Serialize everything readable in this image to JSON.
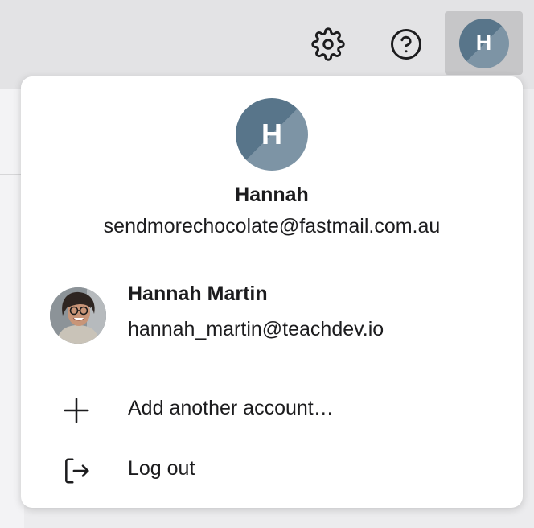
{
  "toolbar": {
    "icons": {
      "settings": "gear-icon",
      "help": "help-icon"
    },
    "avatar_initial": "H"
  },
  "colors": {
    "avatar_dark": "#58758a",
    "avatar_light": "#7d94a5",
    "text": "#1c1c1e",
    "menu_background": "#ffffff",
    "divider": "#dcdcde"
  },
  "account_menu": {
    "current_account": {
      "initial": "H",
      "name": "Hannah",
      "email": "sendmorechocolate@fastmail.com.au"
    },
    "other_accounts": [
      {
        "name": "Hannah Martin",
        "email": "hannah_martin@teachdev.io"
      }
    ],
    "actions": {
      "add_account": {
        "icon": "plus-icon",
        "label": "Add another account…"
      },
      "log_out": {
        "icon": "logout-icon",
        "label": "Log out"
      }
    }
  }
}
